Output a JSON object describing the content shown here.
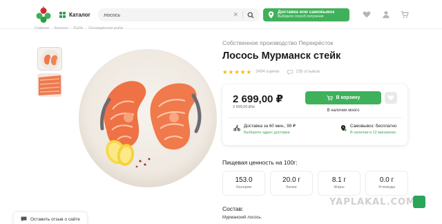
{
  "header": {
    "catalog_label": "Каталог",
    "search_value": "лосось",
    "delivery_title": "Доставка или самовывоз",
    "delivery_subtitle": "Выберите способ получения"
  },
  "breadcrumb": [
    "Главная",
    "Каталог",
    "Рыба",
    "Охлаждённая рыба"
  ],
  "product": {
    "brand_line": "Собственное производство Перекрёсток",
    "title": "Лосось Мурманск стейк",
    "rating_count": "3494 оценки",
    "reviews_count": "235 отзывов",
    "rating_stars": 5
  },
  "price_card": {
    "price": "2 699,00 ₽",
    "price_per_kg": "2 699,00 ₽/кг",
    "cart_label": "В корзину",
    "stock_status": "В наличии много",
    "delivery_option": "Доставка за 60 мин., 99 ₽",
    "delivery_link": "Выберите адрес доставки",
    "pickup_option": "Самовывоз: бесплатно",
    "pickup_link": "В наличии в 12 магазинах"
  },
  "nutrition": {
    "title": "Пищевая ценность на 100г:",
    "items": [
      {
        "value": "153.0",
        "label": "Калории"
      },
      {
        "value": "20.0 г",
        "label": "Белки"
      },
      {
        "value": "8.1 г",
        "label": "Жиры"
      },
      {
        "value": "0.0 г",
        "label": "Углеводы"
      }
    ]
  },
  "composition": {
    "title": "Состав:",
    "text": "Мурманский лосось."
  },
  "feedback": {
    "label": "Оставить отзыв о сайте"
  },
  "watermark": "YAPLAKAL.COM",
  "colors": {
    "brand_green": "#3fb15a",
    "star": "#f5b800",
    "link_green": "#3fa356"
  }
}
